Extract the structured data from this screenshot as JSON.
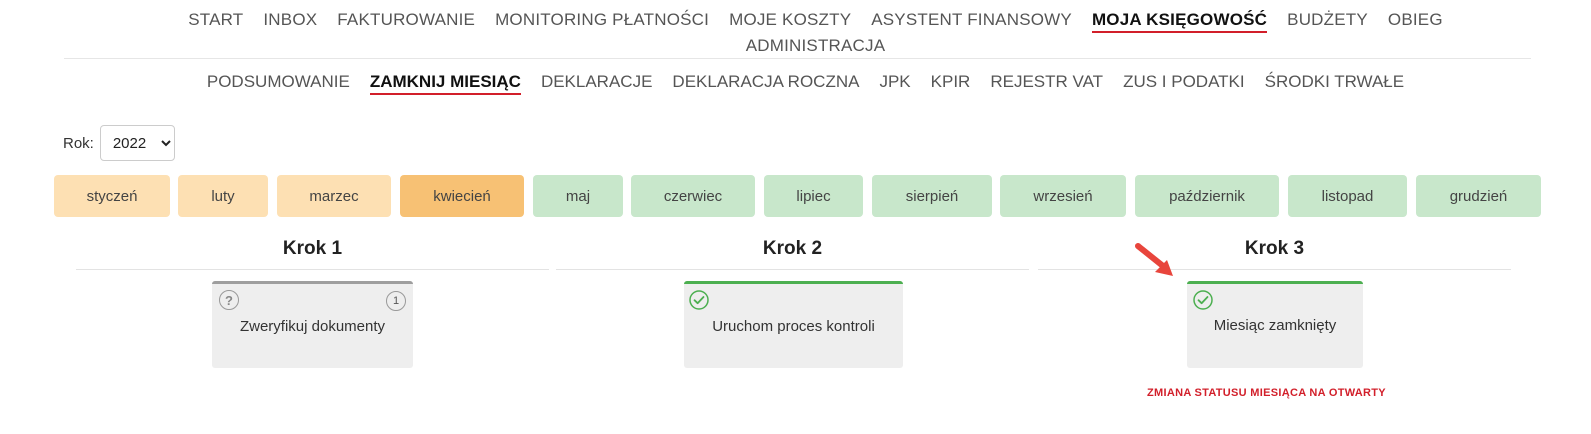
{
  "top_nav": {
    "items": [
      "START",
      "INBOX",
      "FAKTUROWANIE",
      "MONITORING PŁATNOŚCI",
      "MOJE KOSZTY",
      "ASYSTENT FINANSOWY",
      "MOJA KSIĘGOWOŚĆ",
      "BUDŻETY",
      "OBIEG"
    ],
    "row2": [
      "ADMINISTRACJA"
    ],
    "active": "MOJA KSIĘGOWOŚĆ"
  },
  "sub_nav": {
    "items": [
      "PODSUMOWANIE",
      "ZAMKNIJ MIESIĄC",
      "DEKLARACJE",
      "DEKLARACJA ROCZNA",
      "JPK",
      "KPIR",
      "REJESTR VAT",
      "ZUS I PODATKI",
      "ŚRODKI TRWAŁE"
    ],
    "active": "ZAMKNIJ MIESIĄC"
  },
  "year_selector": {
    "label": "Rok:",
    "value": "2022"
  },
  "months": [
    {
      "label": "styczeń",
      "state": "closed"
    },
    {
      "label": "luty",
      "state": "closed"
    },
    {
      "label": "marzec",
      "state": "closed"
    },
    {
      "label": "kwiecień",
      "state": "current"
    },
    {
      "label": "maj",
      "state": "open"
    },
    {
      "label": "czerwiec",
      "state": "open"
    },
    {
      "label": "lipiec",
      "state": "open"
    },
    {
      "label": "sierpień",
      "state": "open"
    },
    {
      "label": "wrzesień",
      "state": "open"
    },
    {
      "label": "październik",
      "state": "open"
    },
    {
      "label": "listopad",
      "state": "open"
    },
    {
      "label": "grudzień",
      "state": "open"
    }
  ],
  "steps": [
    {
      "title": "Krok 1",
      "card": {
        "label": "Zweryfikuj dokumenty",
        "status_icon": "question-icon",
        "badge": "1",
        "bar_color": "#9e9e9e"
      }
    },
    {
      "title": "Krok 2",
      "card": {
        "label": "Uruchom proces kontroli",
        "status_icon": "check-icon",
        "bar_color": "#4caf50"
      }
    },
    {
      "title": "Krok 3",
      "card": {
        "label": "Miesiąc zamknięty",
        "status_icon": "check-icon",
        "bar_color": "#4caf50"
      }
    }
  ],
  "status_link": "ZMIANA STATUSU MIESIĄCA NA OTWARTY",
  "colors": {
    "accent_red": "#d21f2a",
    "month_closed": "#fde0b3",
    "month_current": "#f7c174",
    "month_open": "#c8e7cb",
    "check_green": "#4caf50"
  }
}
